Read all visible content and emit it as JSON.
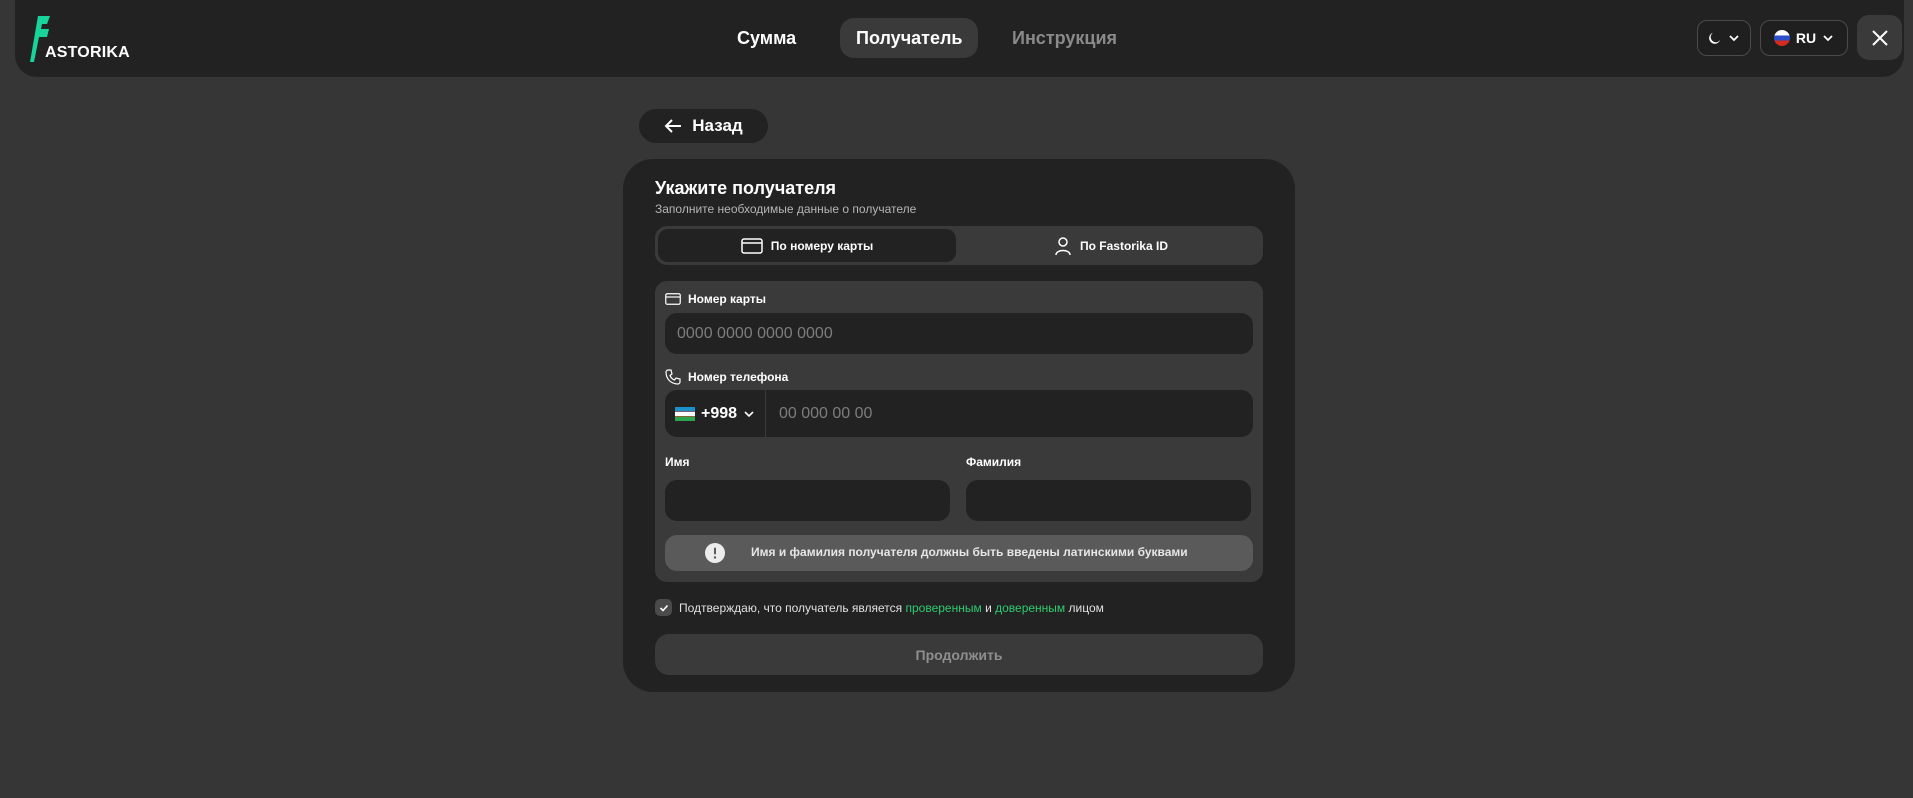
{
  "header": {
    "logo_text": "ASTORIKA",
    "steps": [
      "Сумма",
      "Получатель",
      "Инструкция"
    ],
    "language": "RU"
  },
  "back": {
    "label": "Назад"
  },
  "form": {
    "title": "Укажите получателя",
    "subtitle": "Заполните необходимые данные о получателе",
    "tabs": [
      "По номеру карты",
      "По Fastorika ID"
    ],
    "card_label": "Номер карты",
    "card_placeholder": "0000 0000 0000 0000",
    "phone_label": "Номер телефона",
    "country_code": "+998",
    "phone_placeholder": "00 000 00 00",
    "first_name_label": "Имя",
    "last_name_label": "Фамилия",
    "notice": "Имя и фамилия получателя должны быть введены латинскими буквами",
    "confirm_prefix": "Подтверждаю, что получатель является ",
    "confirm_link1": "проверенным",
    "confirm_and": " и ",
    "confirm_link2": "доверенным",
    "confirm_suffix": " лицом",
    "submit": "Продолжить"
  },
  "colors": {
    "accent": "#2ecc71",
    "background": "#363636",
    "surface": "#222222"
  }
}
